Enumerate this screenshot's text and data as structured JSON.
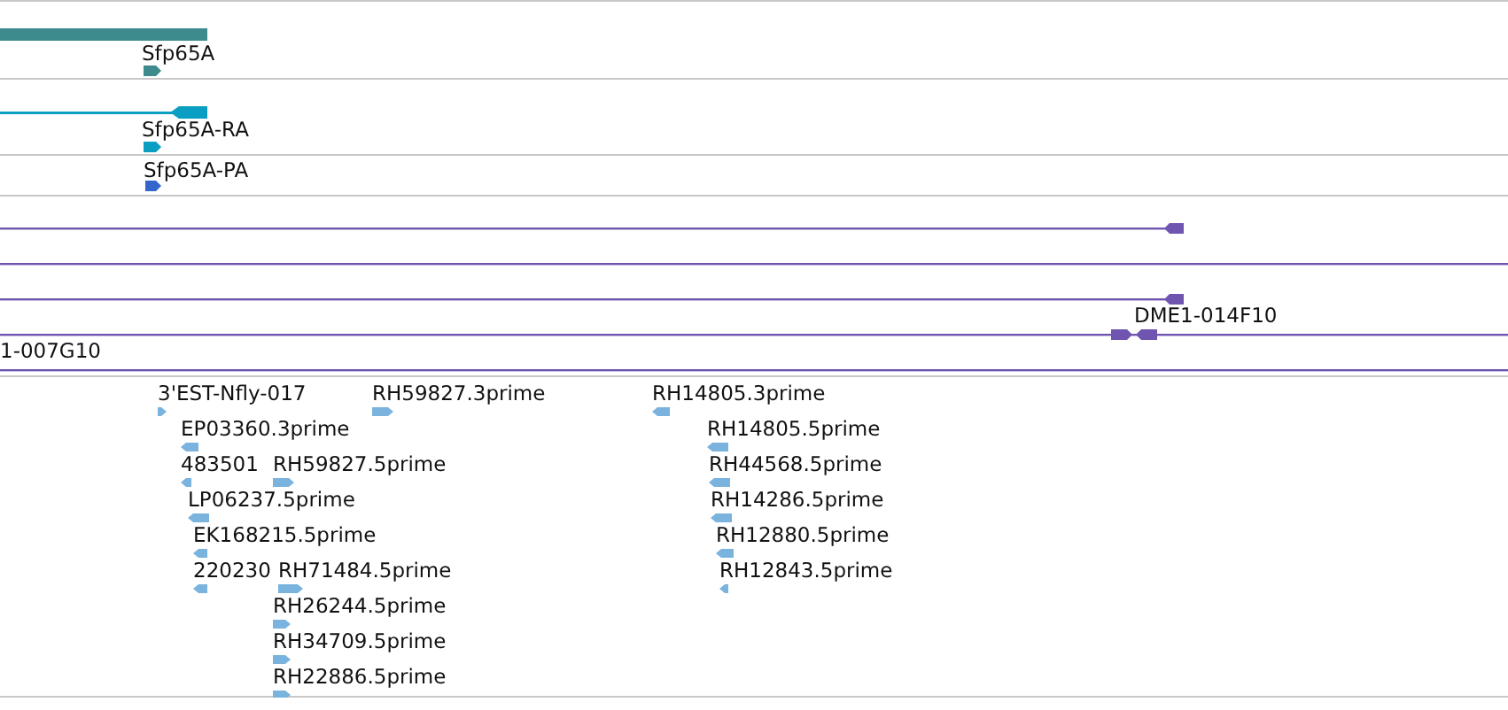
{
  "tracks": [
    {
      "kind": "gene",
      "color": "#3d8b8d",
      "features": [
        {
          "label": "Sfp65A",
          "reverse": false
        }
      ]
    },
    {
      "kind": "transcript",
      "color": "#0a9ec2",
      "features": [
        {
          "label": "Sfp65A-RA",
          "reverse": false
        }
      ]
    },
    {
      "kind": "protein",
      "color": "#3366cc",
      "features": [
        {
          "label": "Sfp65A-PA",
          "reverse": false
        }
      ]
    },
    {
      "kind": "alignment",
      "color": "#7055b0",
      "features": [
        {
          "kind": "ended",
          "reverse": true
        },
        {
          "kind": "line"
        },
        {
          "kind": "ended",
          "reverse": true,
          "label": "DME1-014F10"
        },
        {
          "kind": "paired",
          "label": "1-007G10"
        },
        {
          "kind": "line"
        }
      ]
    },
    {
      "kind": "est",
      "color": "#7ab3de",
      "features": [
        {
          "label": "3'EST-Nfly-017",
          "reverse": false
        },
        {
          "label": "RH59827.3prime",
          "reverse": false
        },
        {
          "label": "RH14805.3prime",
          "reverse": true
        },
        {
          "label": "EP03360.3prime",
          "reverse": true
        },
        {
          "label": "RH14805.5prime",
          "reverse": true
        },
        {
          "label": "483501",
          "reverse": true
        },
        {
          "label": "RH59827.5prime",
          "reverse": false
        },
        {
          "label": "RH44568.5prime",
          "reverse": true
        },
        {
          "label": "LP06237.5prime",
          "reverse": true
        },
        {
          "label": "RH14286.5prime",
          "reverse": true
        },
        {
          "label": "EK168215.5prime",
          "reverse": true
        },
        {
          "label": "RH12880.5prime",
          "reverse": true
        },
        {
          "label": "220230",
          "reverse": true
        },
        {
          "label": "RH71484.5prime",
          "reverse": false
        },
        {
          "label": "RH12843.5prime",
          "reverse": true
        },
        {
          "label": "RH26244.5prime",
          "reverse": false
        },
        {
          "label": "RH34709.5prime",
          "reverse": false
        },
        {
          "label": "RH22886.5prime",
          "reverse": false
        }
      ]
    }
  ]
}
